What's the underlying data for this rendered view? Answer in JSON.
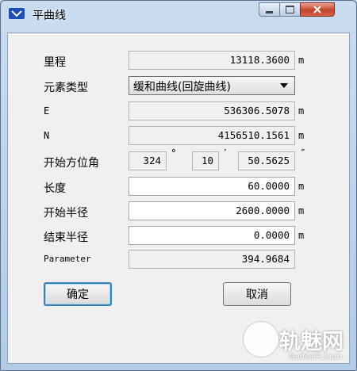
{
  "window": {
    "title": "平曲线"
  },
  "fields": {
    "mileage": {
      "label": "里程",
      "value": "13118.3600",
      "unit": "m"
    },
    "element_type": {
      "label": "元素类型",
      "value": "缓和曲线(回旋曲线)"
    },
    "e": {
      "label": "E",
      "value": "536306.5078",
      "unit": "m"
    },
    "n": {
      "label": "N",
      "value": "4156510.1561",
      "unit": "m"
    },
    "start_azimuth": {
      "label": "开始方位角",
      "degrees": "324",
      "deg_symbol": "°",
      "minutes": "10",
      "min_symbol": "′",
      "seconds": "50.5625",
      "sec_symbol": "″"
    },
    "length": {
      "label": "长度",
      "value": "60.0000",
      "unit": "m"
    },
    "start_radius": {
      "label": "开始半径",
      "value": "2600.0000",
      "unit": "m"
    },
    "end_radius": {
      "label": "结束半径",
      "value": "0.0000",
      "unit": "m"
    },
    "parameter": {
      "label": "Parameter",
      "value": "394.9684"
    }
  },
  "buttons": {
    "ok": "确定",
    "cancel": "取消"
  },
  "watermark": {
    "text": "轨魅网",
    "sub": "GuiMeiR.Com"
  }
}
